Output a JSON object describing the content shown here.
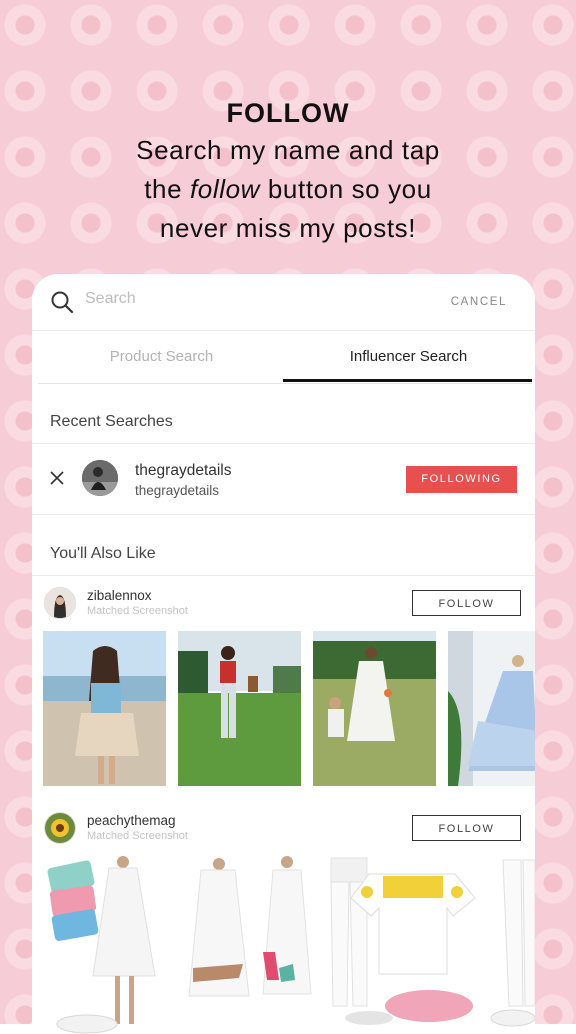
{
  "promo": {
    "heading": "FOLLOW",
    "line1": "Search my name and tap",
    "line2_pre": "the ",
    "line2_em": "follow",
    "line2_post": " button so you",
    "line3": "never miss my posts!"
  },
  "search": {
    "placeholder": "Search",
    "cancel_label": "CANCEL"
  },
  "tabs": [
    {
      "label": "Product Search",
      "active": false
    },
    {
      "label": "Influencer Search",
      "active": true
    }
  ],
  "recent": {
    "title": "Recent Searches",
    "items": [
      {
        "name": "thegraydetails",
        "handle": "thegraydetails",
        "button": "FOLLOWING"
      }
    ]
  },
  "suggestions": {
    "title": "You'll Also Like",
    "items": [
      {
        "name": "zibalennox",
        "subtitle": "Matched Screenshot",
        "button": "FOLLOW"
      },
      {
        "name": "peachythemag",
        "subtitle": "Matched Screenshot",
        "button": "FOLLOW"
      }
    ]
  },
  "colors": {
    "background": "#f6cdd6",
    "following_button": "#e8504f",
    "tab_underline": "#111111"
  }
}
